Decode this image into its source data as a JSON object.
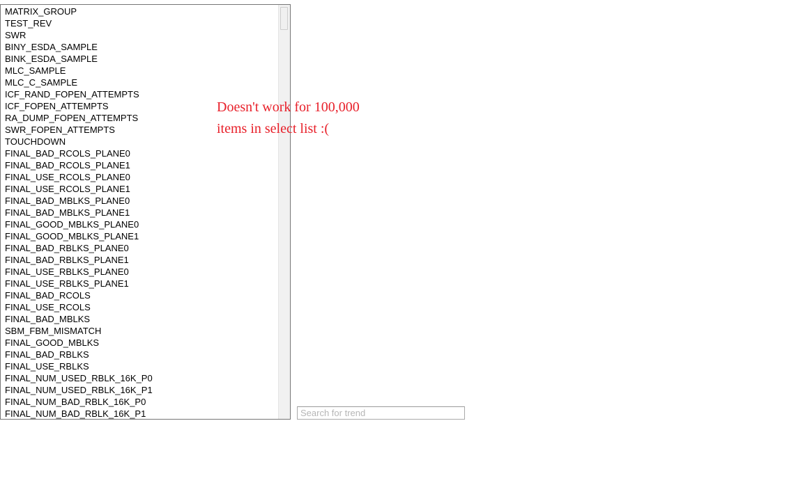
{
  "select_list": {
    "name": "trend-select-list",
    "size_visible_rows": 35,
    "options": [
      "MATRIX_GROUP",
      "TEST_REV",
      "SWR",
      "BINY_ESDA_SAMPLE",
      "BINK_ESDA_SAMPLE",
      "MLC_SAMPLE",
      "MLC_C_SAMPLE",
      "ICF_RAND_FOPEN_ATTEMPTS",
      "ICF_FOPEN_ATTEMPTS",
      "RA_DUMP_FOPEN_ATTEMPTS",
      "SWR_FOPEN_ATTEMPTS",
      "TOUCHDOWN",
      "FINAL_BAD_RCOLS_PLANE0",
      "FINAL_BAD_RCOLS_PLANE1",
      "FINAL_USE_RCOLS_PLANE0",
      "FINAL_USE_RCOLS_PLANE1",
      "FINAL_BAD_MBLKS_PLANE0",
      "FINAL_BAD_MBLKS_PLANE1",
      "FINAL_GOOD_MBLKS_PLANE0",
      "FINAL_GOOD_MBLKS_PLANE1",
      "FINAL_BAD_RBLKS_PLANE0",
      "FINAL_BAD_RBLKS_PLANE1",
      "FINAL_USE_RBLKS_PLANE0",
      "FINAL_USE_RBLKS_PLANE1",
      "FINAL_BAD_RCOLS",
      "FINAL_USE_RCOLS",
      "FINAL_BAD_MBLKS",
      "SBM_FBM_MISMATCH",
      "FINAL_GOOD_MBLKS",
      "FINAL_BAD_RBLKS",
      "FINAL_USE_RBLKS",
      "FINAL_NUM_USED_RBLK_16K_P0",
      "FINAL_NUM_USED_RBLK_16K_P1",
      "FINAL_NUM_BAD_RBLK_16K_P0",
      "FINAL_NUM_BAD_RBLK_16K_P1"
    ]
  },
  "scrollbar": {
    "orientation": "vertical",
    "thumb_position": "top"
  },
  "search": {
    "value": "",
    "placeholder": "Search for trend"
  },
  "annotation": {
    "text": "Doesn't work for 100,000\nitems in select list :(",
    "color": "#e8202a"
  }
}
